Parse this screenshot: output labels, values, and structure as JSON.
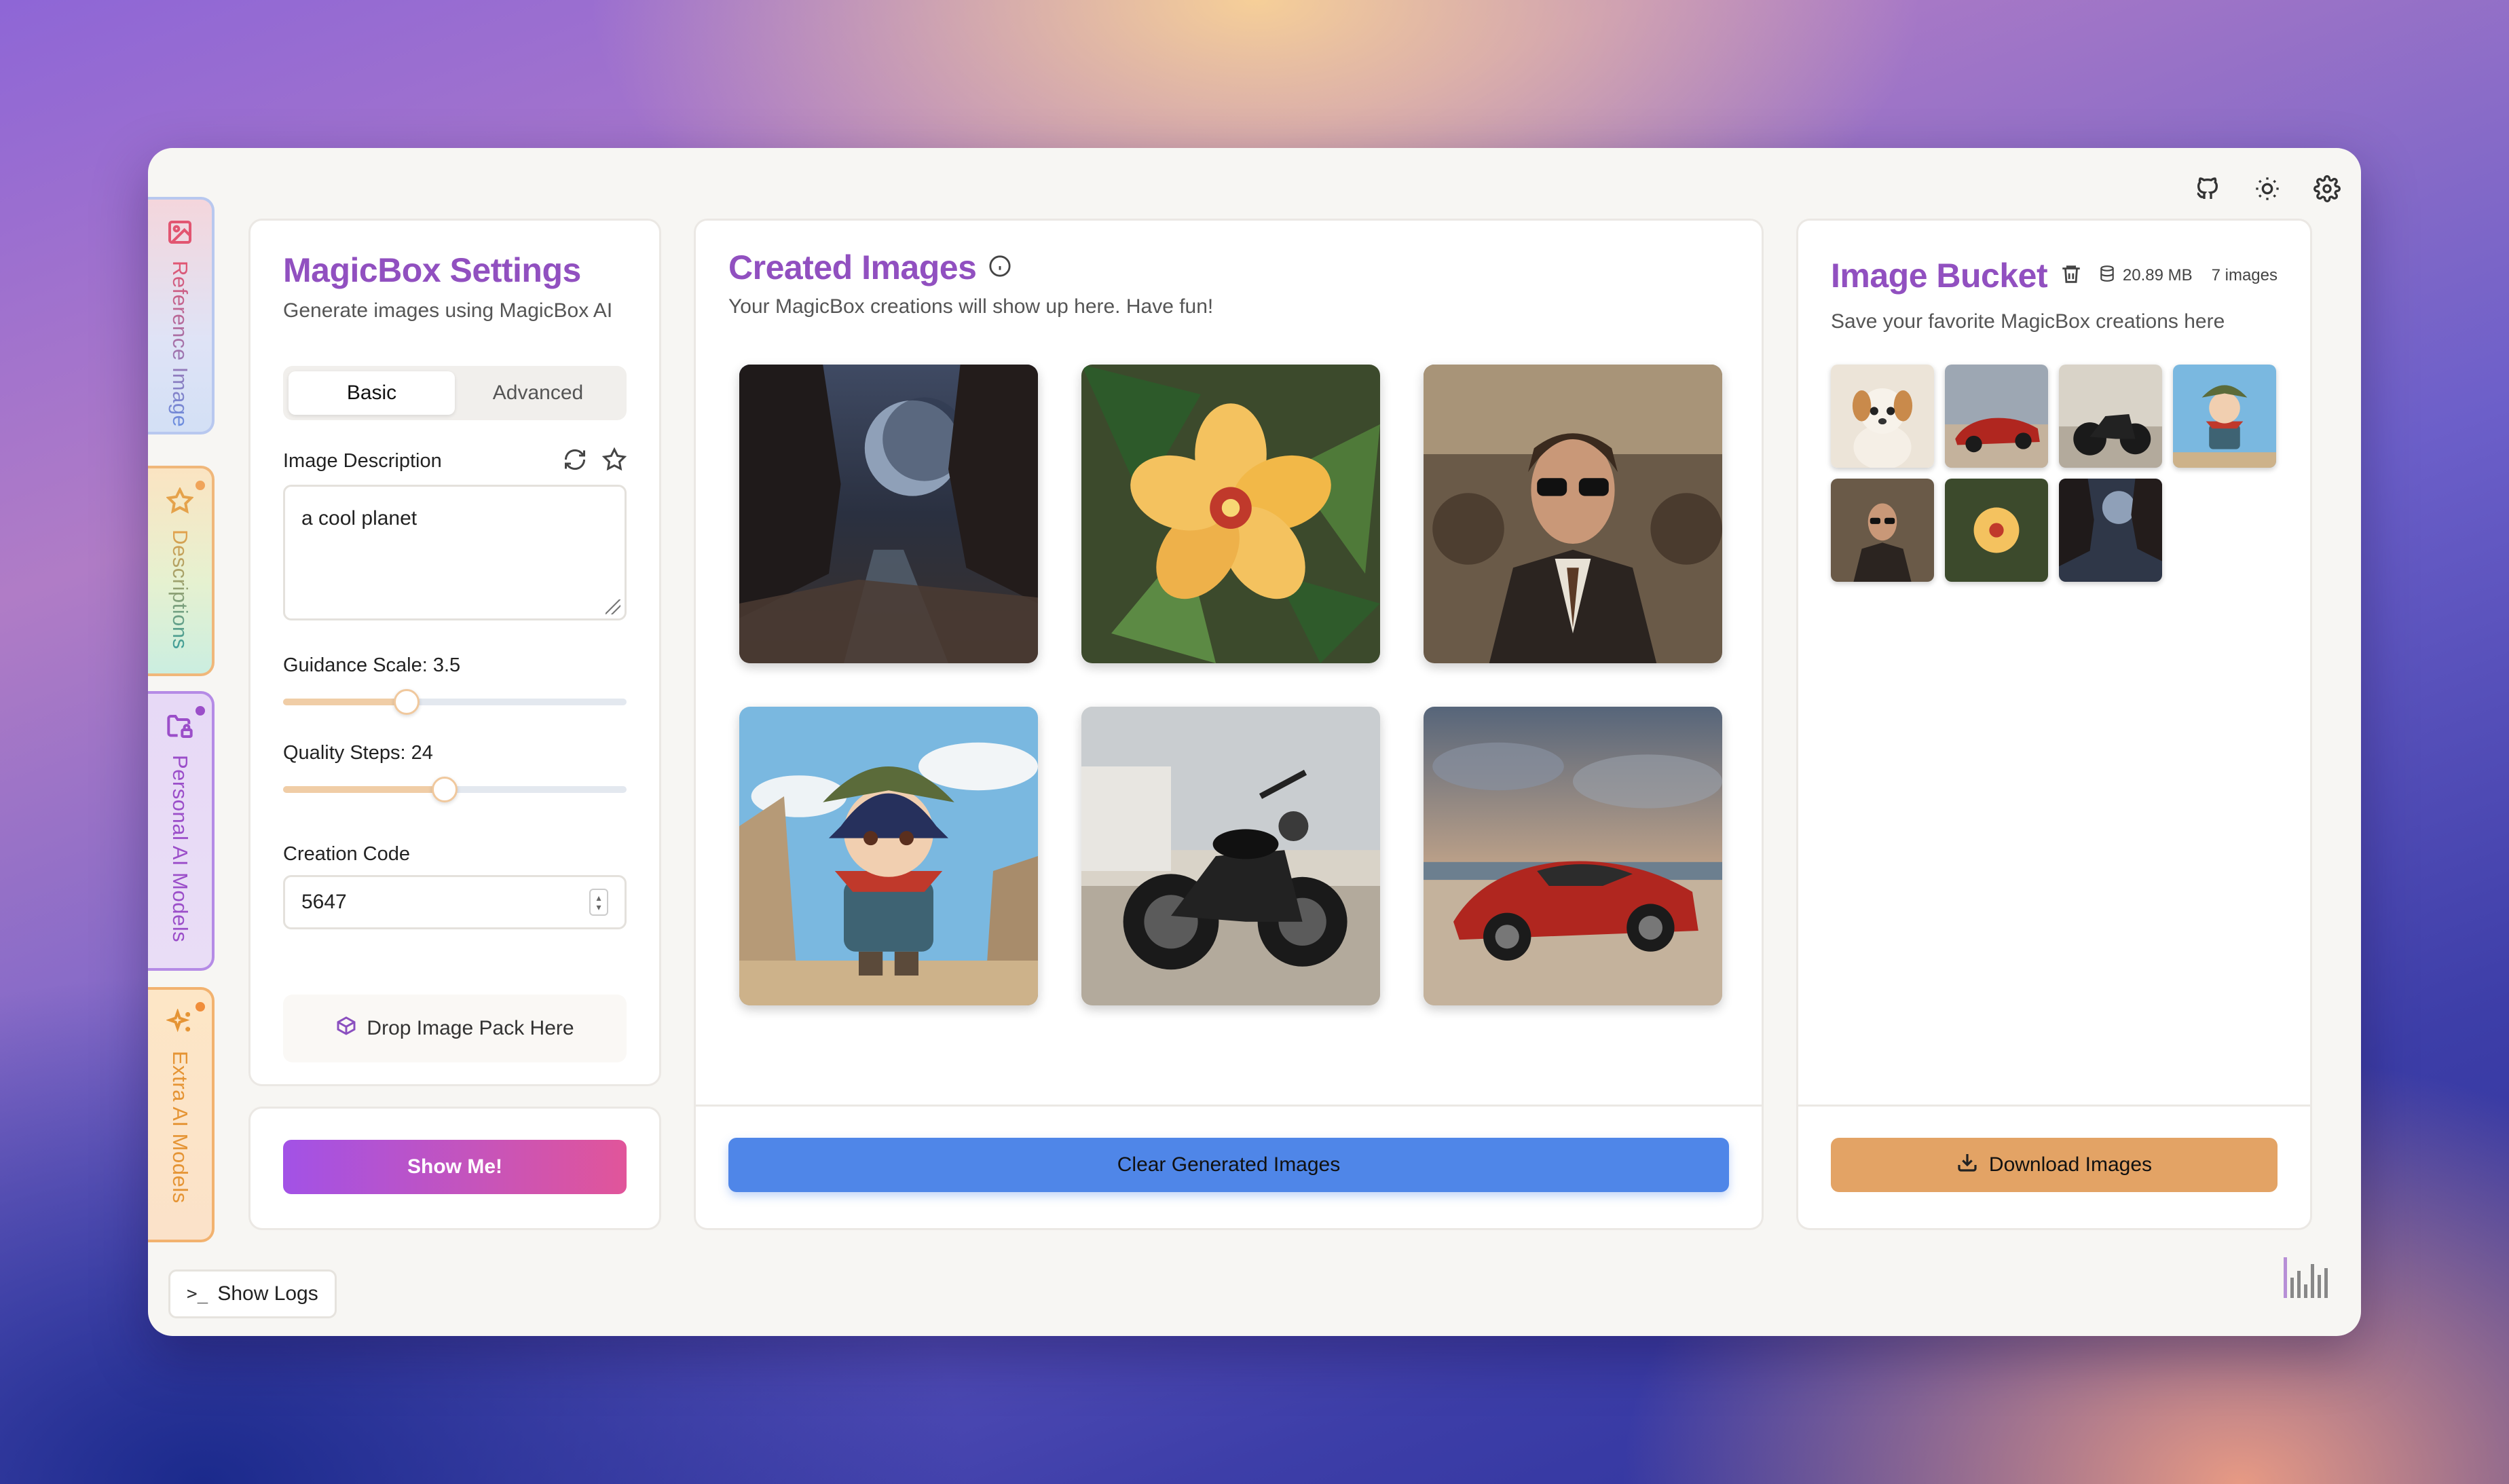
{
  "sidebar_tabs": [
    {
      "label": "Reference Image",
      "icon": "image-icon"
    },
    {
      "label": "Descriptions",
      "icon": "star-icon"
    },
    {
      "label": "Personal AI Models",
      "icon": "folder-lock-icon"
    },
    {
      "label": "Extra AI Models",
      "icon": "sparkles-icon"
    }
  ],
  "header_icons": [
    "github-icon",
    "sun-icon",
    "gear-icon"
  ],
  "settings": {
    "title": "MagicBox Settings",
    "subtitle": "Generate images using MagicBox AI",
    "tabs": [
      "Basic",
      "Advanced"
    ],
    "active_tab": "Basic",
    "description_label": "Image Description",
    "description_value": "a cool planet",
    "guidance_label": "Guidance Scale: 3.5",
    "guidance_fraction": 0.36,
    "quality_label": "Quality Steps: 24",
    "quality_fraction": 0.47,
    "code_label": "Creation Code",
    "code_value": "5647",
    "drop_label": "Drop Image Pack Here",
    "show_button": "Show Me!"
  },
  "created": {
    "title": "Created Images",
    "subtitle": "Your MagicBox creations will show up here. Have fun!",
    "images": [
      "planet-canyon",
      "yellow-hibiscus",
      "man-in-sunglasses",
      "chibi-adventurer",
      "black-motorcycle",
      "red-sports-car"
    ],
    "clear_button": "Clear Generated Images"
  },
  "bucket": {
    "title": "Image Bucket",
    "size": "20.89 MB",
    "count": "7 images",
    "subtitle": "Save your favorite MagicBox creations here",
    "thumbs": [
      "puppy",
      "red-sports-car",
      "black-motorcycle",
      "chibi-adventurer",
      "man-in-sunglasses",
      "yellow-hibiscus",
      "planet-canyon"
    ],
    "download_button": "Download Images"
  },
  "logs_button": "Show Logs",
  "colors": {
    "accent_purple": "#9150c0",
    "clear_blue": "#4f86e8",
    "download_orange": "#e3a365"
  }
}
